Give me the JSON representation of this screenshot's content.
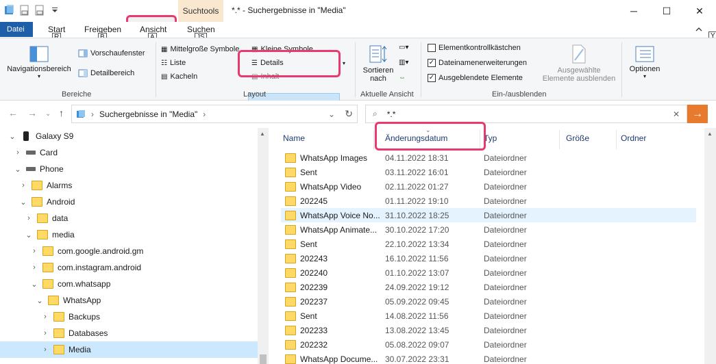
{
  "window": {
    "context_tab": "Suchtools",
    "title": "*.* - Suchergebnisse in \"Media\"",
    "min": "─",
    "max": "☐",
    "close": "✕"
  },
  "tabs": {
    "file": "Datei",
    "start": "Start",
    "share": "Freigeben",
    "view": "Ansicht",
    "search": "Suchen",
    "keytips": {
      "start": "R",
      "share": "B",
      "view": "A",
      "search": "JS",
      "help": "Y"
    }
  },
  "ribbon": {
    "bereiche": {
      "label": "Bereiche",
      "nav": "Navigationsbereich",
      "preview": "Vorschaufenster",
      "details": "Detailbereich"
    },
    "layout": {
      "label": "Layout",
      "medium": "Mittelgroße Symbole",
      "small": "Kleine Symbole",
      "list": "Liste",
      "details": "Details",
      "tiles": "Kacheln",
      "content": "Inhalt"
    },
    "current_view": {
      "label": "Aktuelle Ansicht",
      "sort_line1": "Sortieren",
      "sort_line2": "nach"
    },
    "show_hide": {
      "label": "Ein-/ausblenden",
      "checkboxes": "Elementkontrollkästchen",
      "extensions": "Dateinamenerweiterungen",
      "hidden": "Ausgeblendete Elemente",
      "hide_selected_1": "Ausgewählte",
      "hide_selected_2": "Elemente ausblenden",
      "options": "Optionen"
    }
  },
  "address": {
    "path": "Suchergebnisse in \"Media\"",
    "search_query": "*.*"
  },
  "tree": [
    {
      "label": "Galaxy S9",
      "level": 0,
      "chev": "⌄",
      "icon": "phone"
    },
    {
      "label": "Card",
      "level": 1,
      "chev": "›",
      "icon": "drive"
    },
    {
      "label": "Phone",
      "level": 1,
      "chev": "⌄",
      "icon": "drive"
    },
    {
      "label": "Alarms",
      "level": 2,
      "chev": "›",
      "icon": "folder"
    },
    {
      "label": "Android",
      "level": 2,
      "chev": "⌄",
      "icon": "folder"
    },
    {
      "label": "data",
      "level": 3,
      "chev": "›",
      "icon": "folder"
    },
    {
      "label": "media",
      "level": 3,
      "chev": "⌄",
      "icon": "folder"
    },
    {
      "label": "com.google.android.gm",
      "level": 4,
      "chev": "›",
      "icon": "folder"
    },
    {
      "label": "com.instagram.android",
      "level": 4,
      "chev": "›",
      "icon": "folder"
    },
    {
      "label": "com.whatsapp",
      "level": 4,
      "chev": "⌄",
      "icon": "folder"
    },
    {
      "label": "WhatsApp",
      "level": 5,
      "chev": "⌄",
      "icon": "folder"
    },
    {
      "label": "Backups",
      "level": 6,
      "chev": "›",
      "icon": "folder"
    },
    {
      "label": "Databases",
      "level": 6,
      "chev": "›",
      "icon": "folder"
    },
    {
      "label": "Media",
      "level": 6,
      "chev": "›",
      "icon": "folder",
      "selected": true
    }
  ],
  "columns": {
    "name": "Name",
    "date": "Änderungsdatum",
    "type": "Typ",
    "size": "Größe",
    "folder": "Ordner"
  },
  "files": [
    {
      "name": "WhatsApp Images",
      "date": "04.11.2022 18:31",
      "type": "Dateiordner"
    },
    {
      "name": "Sent",
      "date": "03.11.2022 16:01",
      "type": "Dateiordner"
    },
    {
      "name": "WhatsApp Video",
      "date": "02.11.2022 01:27",
      "type": "Dateiordner"
    },
    {
      "name": "202245",
      "date": "01.11.2022 19:10",
      "type": "Dateiordner"
    },
    {
      "name": "WhatsApp Voice No...",
      "date": "31.10.2022 18:25",
      "type": "Dateiordner",
      "hover": true
    },
    {
      "name": "WhatsApp Animate...",
      "date": "30.10.2022 17:20",
      "type": "Dateiordner"
    },
    {
      "name": "Sent",
      "date": "22.10.2022 13:34",
      "type": "Dateiordner"
    },
    {
      "name": "202243",
      "date": "16.10.2022 11:56",
      "type": "Dateiordner"
    },
    {
      "name": "202240",
      "date": "01.10.2022 13:07",
      "type": "Dateiordner"
    },
    {
      "name": "202239",
      "date": "24.09.2022 19:12",
      "type": "Dateiordner"
    },
    {
      "name": "202237",
      "date": "05.09.2022 09:45",
      "type": "Dateiordner"
    },
    {
      "name": "Sent",
      "date": "14.08.2022 11:56",
      "type": "Dateiordner"
    },
    {
      "name": "202233",
      "date": "13.08.2022 13:45",
      "type": "Dateiordner"
    },
    {
      "name": "202232",
      "date": "05.08.2022 09:07",
      "type": "Dateiordner"
    },
    {
      "name": "WhatsApp Docume...",
      "date": "30.07.2022 23:31",
      "type": "Dateiordner"
    }
  ]
}
